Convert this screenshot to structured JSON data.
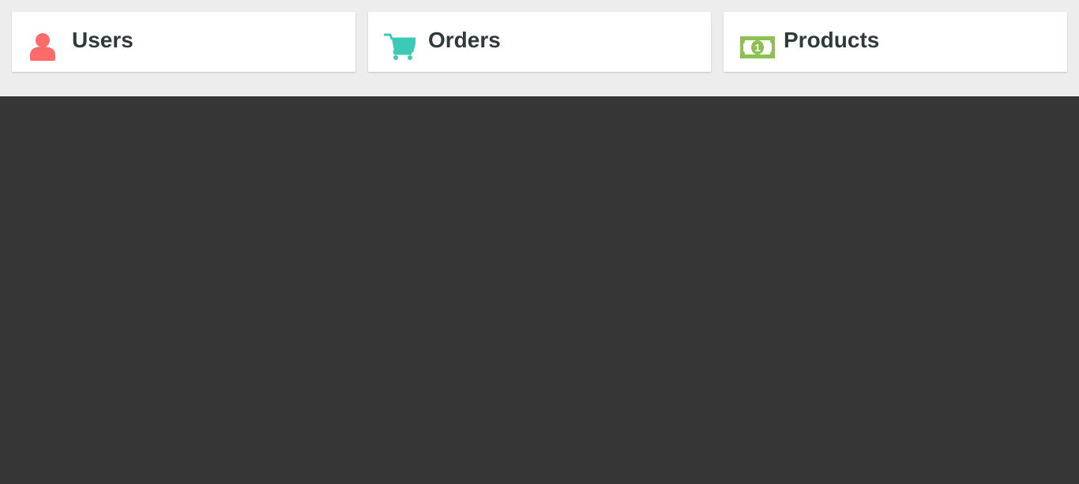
{
  "cards": [
    {
      "label": "Users",
      "icon": "user-icon",
      "color": "#ff6b6b"
    },
    {
      "label": "Orders",
      "icon": "shopping-cart-icon",
      "color": "#3cc9b6"
    },
    {
      "label": "Products",
      "icon": "money-bill-icon",
      "color": "#8cc152"
    }
  ],
  "colors": {
    "top_background": "#ededed",
    "main_background": "#363636",
    "card_background": "#ffffff",
    "label_text": "#2f3b3b"
  }
}
